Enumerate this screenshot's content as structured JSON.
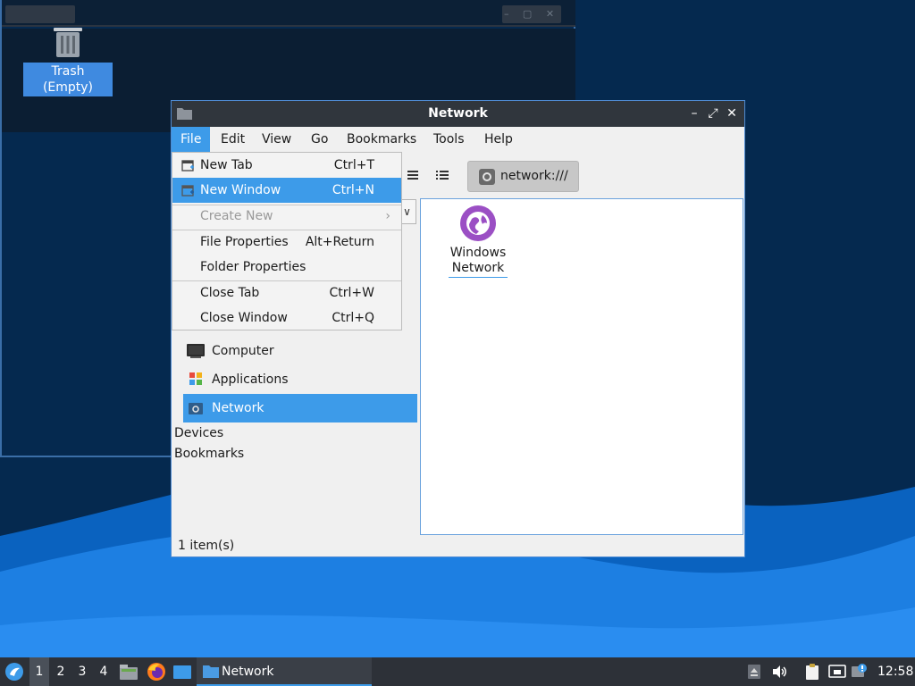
{
  "colors": {
    "accent": "#3d9be9",
    "titlebar": "#30363d",
    "desktop": "#05294f",
    "wave": "#1d7fe2",
    "taskbar": "#2d3138"
  },
  "desktop": {
    "trash_label": "Trash (Empty)",
    "trash_icon": "trash-icon"
  },
  "window": {
    "title": "Network",
    "icon": "folder-icon",
    "controls": {
      "minimize": "–",
      "maximize": "⤢",
      "close": "✕"
    }
  },
  "menubar": {
    "items": [
      "File",
      "Edit",
      "View",
      "Go",
      "Bookmarks",
      "Tools",
      "Help"
    ],
    "active": "File"
  },
  "file_menu": {
    "items": [
      {
        "label": "New Tab",
        "shortcut": "Ctrl+T",
        "icon": "new-tab-icon",
        "state": "normal"
      },
      {
        "label": "New Window",
        "shortcut": "Ctrl+N",
        "icon": "new-window-icon",
        "state": "highlighted"
      },
      {
        "label": "Create New",
        "shortcut": "",
        "icon": "",
        "state": "disabled",
        "submenu_arrow": "›"
      },
      {
        "label": "File Properties",
        "shortcut": "Alt+Return",
        "icon": "",
        "state": "normal"
      },
      {
        "label": "Folder Properties",
        "shortcut": "",
        "icon": "",
        "state": "normal"
      },
      {
        "label": "Close Tab",
        "shortcut": "Ctrl+W",
        "icon": "",
        "state": "normal"
      },
      {
        "label": "Close Window",
        "shortcut": "Ctrl+Q",
        "icon": "",
        "state": "normal"
      }
    ]
  },
  "toolbar": {
    "address": "network:///",
    "view_icons": [
      "list-view-icon",
      "detailed-list-view-icon"
    ],
    "combo_arrow": "∨"
  },
  "sidebar": {
    "places": [
      {
        "label": "Computer",
        "icon": "computer-icon",
        "selected": false
      },
      {
        "label": "Applications",
        "icon": "applications-icon",
        "selected": false
      },
      {
        "label": "Network",
        "icon": "network-icon",
        "selected": true
      }
    ],
    "sections": [
      "Devices",
      "Bookmarks"
    ]
  },
  "content": {
    "items": [
      {
        "label_line1": "Windows",
        "label_line2": "Network",
        "icon": "windows-network-icon"
      }
    ]
  },
  "statusbar": {
    "text": "1 item(s)"
  },
  "taskbar": {
    "start_icon": "lxqt-start-icon",
    "desktops": [
      "1",
      "2",
      "3",
      "4"
    ],
    "active_desktop": "1",
    "launchers": [
      "file-manager-icon",
      "firefox-icon",
      "show-desktop-icon"
    ],
    "task": {
      "label": "Network",
      "icon": "folder-icon"
    },
    "tray": [
      "eject-icon",
      "volume-icon",
      "clipboard-icon",
      "network-status-icon",
      "update-notifier-icon"
    ],
    "clock": "12:58"
  }
}
